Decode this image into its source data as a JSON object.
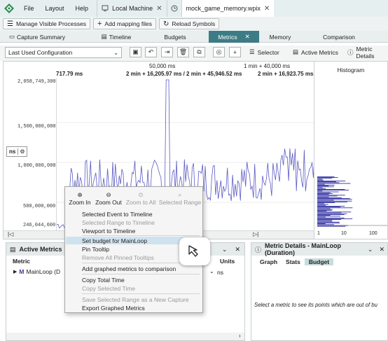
{
  "menubar": {
    "items": [
      "File",
      "Layout",
      "Help"
    ],
    "tabs": [
      {
        "label": "Local Machine",
        "icon": "monitor-icon",
        "active": false
      },
      {
        "label": "mock_game_memory.wpix",
        "icon": "clock-icon",
        "active": true
      }
    ]
  },
  "toolbar": {
    "manage": "Manage Visible Processes",
    "add_mapping": "Add mapping files",
    "reload": "Reload Symbols"
  },
  "viewtabs": [
    "Capture Summary",
    "Timeline",
    "Budgets",
    "Metrics",
    "Memory",
    "Comparison"
  ],
  "config": {
    "dropdown": "Last Used Configuration",
    "selector": "Selector",
    "active_metrics": "Active Metrics",
    "metric_details": "Metric Details"
  },
  "ruler": {
    "center_top": "50,000 ms",
    "right_top": "1 min + 40,000 ms",
    "left": "717.79 ms",
    "center_bottom": "2 min + 16,205.97 ms / 2 min + 45,946.52 ms",
    "right_bottom": "2 min + 16,923.75 ms"
  },
  "y_axis": {
    "labels": [
      "2,058,749,300",
      "1,500,000,000",
      "1,000,000,000",
      "500,000,000",
      "246,044,600"
    ],
    "unit_badge": "ns"
  },
  "histogram": {
    "title": "Histogram",
    "ticks": [
      "1",
      "10",
      "100"
    ]
  },
  "context_menu": {
    "zoom_tools": [
      {
        "label": "Zoom In",
        "enabled": true
      },
      {
        "label": "Zoom Out",
        "enabled": true
      },
      {
        "label": "Zoom to All",
        "enabled": false
      },
      {
        "label": "Selected Range",
        "enabled": false
      }
    ],
    "items": [
      {
        "label": "Selected Event to Timeline",
        "enabled": true
      },
      {
        "label": "Selected Range to Timeline",
        "enabled": false
      },
      {
        "label": "Viewport to Timeline",
        "enabled": true
      },
      {
        "label": "Set budget for MainLoop",
        "enabled": true,
        "highlighted": true
      },
      {
        "label": "Pin Tooltip",
        "enabled": true
      },
      {
        "label": "Remove All Pinned Tooltips",
        "enabled": false
      },
      {
        "label": "Add graphed metrics to comparison",
        "enabled": true
      },
      {
        "label": "Copy Total Time",
        "enabled": true
      },
      {
        "label": "Copy Selected Time",
        "enabled": false
      },
      {
        "label": "Save Selected Range as a New Capture",
        "enabled": false
      },
      {
        "label": "Export Graphed Metrics",
        "enabled": true
      }
    ]
  },
  "active_metrics": {
    "title": "Active Metrics",
    "col_metric": "Metric",
    "col_units": "Units",
    "row_name": "MainLoop (D",
    "row_units": "ns"
  },
  "metric_details": {
    "title": "Metric Details - MainLoop (Duration)",
    "tabs": [
      "Graph",
      "Stats",
      "Budget"
    ],
    "active_tab": "Budget",
    "message": "Select a metric to see its points which are out of bu"
  }
}
